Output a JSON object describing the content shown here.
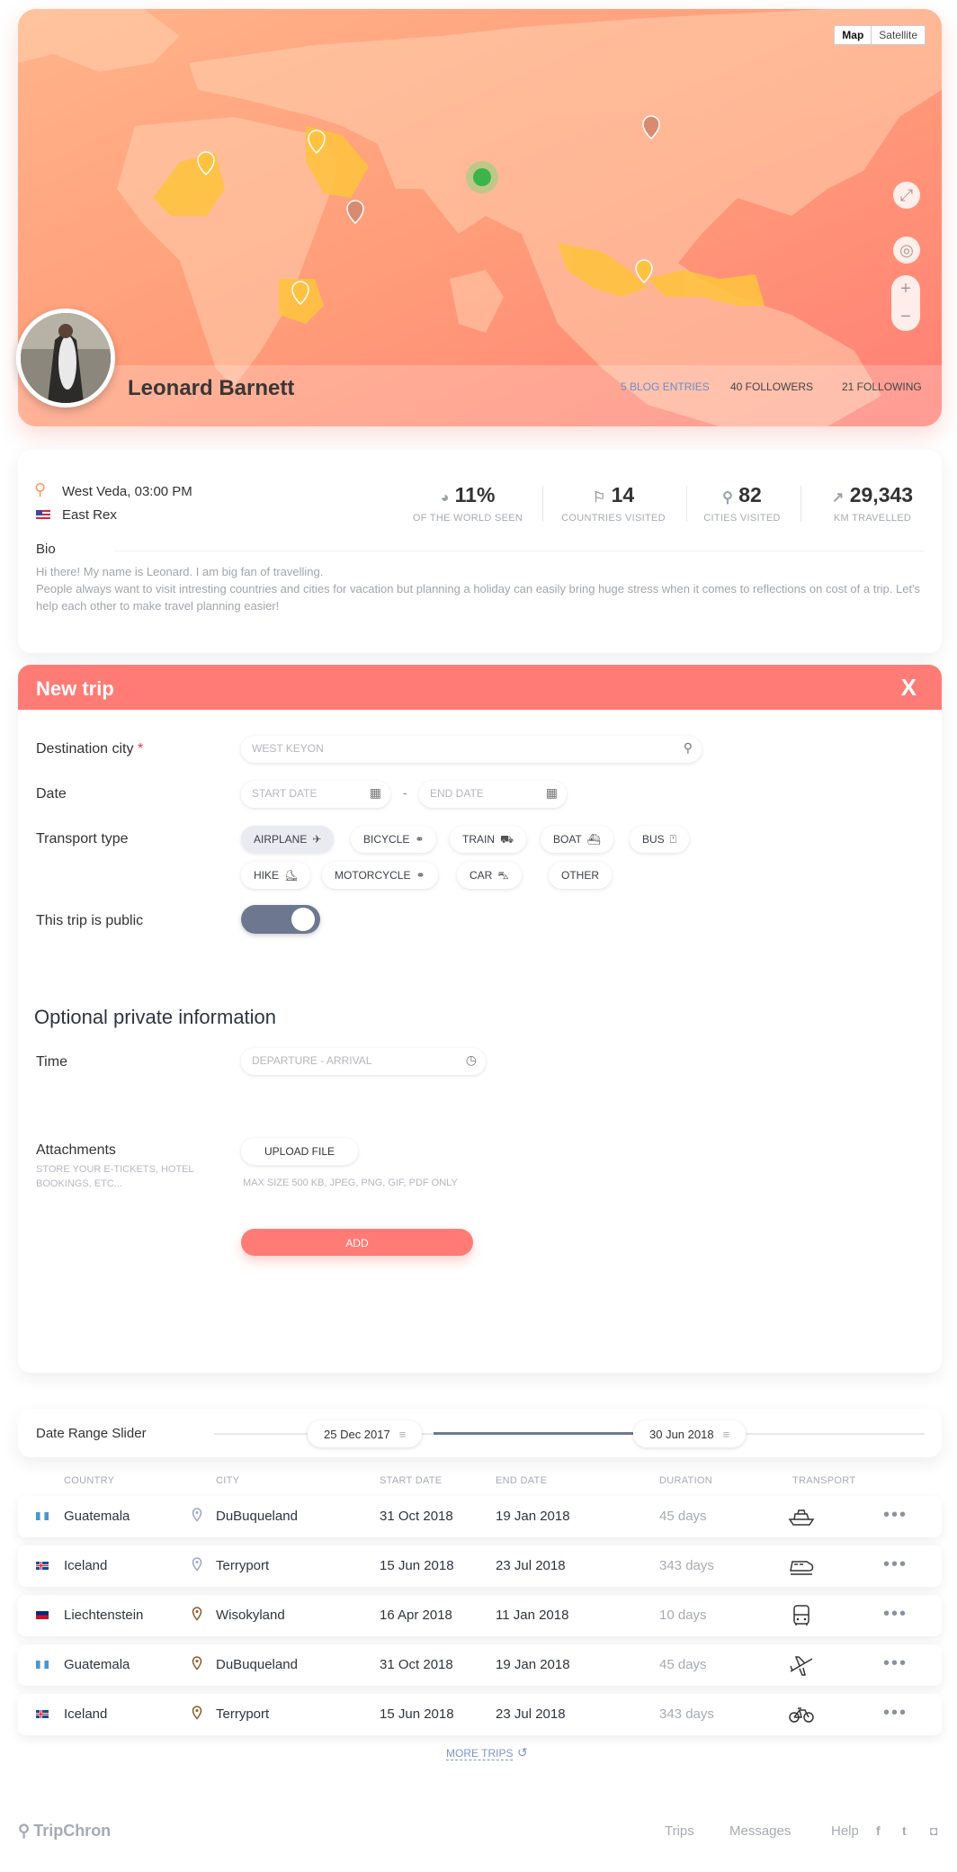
{
  "map": {
    "toggle": {
      "map": "Map",
      "satellite": "Satellite"
    },
    "profile": {
      "name": "Leonard Barnett",
      "blog_entries": "5 BLOG ENTRIES",
      "followers": "40 FOLLOWERS",
      "following": "21 FOLLOWING"
    }
  },
  "info": {
    "location": "West Veda, 03:00 PM",
    "home": "East Rex",
    "stats": [
      {
        "value": "11%",
        "label": "OF THE WORLD SEEN",
        "icon": "globe-icon"
      },
      {
        "value": "14",
        "label": "COUNTRIES VISITED",
        "icon": "flag-icon"
      },
      {
        "value": "82",
        "label": "CITIES VISITED",
        "icon": "pin-icon"
      },
      {
        "value": "29,343",
        "label": "KM TRAVELLED",
        "icon": "route-icon"
      }
    ],
    "bio_title": "Bio",
    "bio_text": "Hi there! My name is Leonard. I am big fan of travelling.\nPeople always want to visit intresting countries and cities for vacation but planning a holiday can easily bring huge stress when it comes to reflections on cost of a trip. Let's help each other to make travel planning easier!"
  },
  "trip": {
    "title": "New trip",
    "close": "X",
    "destination_label": "Destination city",
    "required_mark": "*",
    "destination_value": "WEST KEYON",
    "date_label": "Date",
    "start_placeholder": "START DATE",
    "date_sep": "-",
    "end_placeholder": "END DATE",
    "transport_label": "Transport type",
    "transports": [
      "AIRPLANE",
      "BICYCLE",
      "TRAIN",
      "BOAT",
      "BUS",
      "HIKE",
      "MOTORCYCLE",
      "CAR",
      "OTHER"
    ],
    "selected_transport": "AIRPLANE",
    "public_label": "This trip is public",
    "public_on": true,
    "optional_title": "Optional private information",
    "time_label": "Time",
    "time_placeholder": "DEPARTURE - ARRIVAL",
    "attachments_label": "Attachments",
    "attachments_sub": "STORE YOUR E-TICKETS, HOTEL BOOKINGS, ETC...",
    "upload_label": "UPLOAD FILE",
    "upload_hint": "MAX SIZE 500 KB, JPEG, PNG, GIF, PDF ONLY",
    "add_label": "ADD"
  },
  "slider": {
    "label": "Date Range Slider",
    "start": "25 Dec 2017",
    "end": "30 Jun 2018"
  },
  "table": {
    "headers": [
      "COUNTRY",
      "CITY",
      "START DATE",
      "END DATE",
      "DURATION",
      "TRANSPORT"
    ],
    "rows": [
      {
        "country": "Guatemala",
        "city": "DuBuqueland",
        "start": "31 Oct 2018",
        "end": "19 Jan 2018",
        "duration": "45 days",
        "transport": "boat-icon",
        "flag": "guatemala",
        "pin": "light"
      },
      {
        "country": "Iceland",
        "city": "Terryport",
        "start": "15 Jun 2018",
        "end": "23 Jul 2018",
        "duration": "343 days",
        "transport": "train-icon",
        "flag": "iceland",
        "pin": "light"
      },
      {
        "country": "Liechtenstein",
        "city": "Wisokyland",
        "start": "16 Apr 2018",
        "end": "11 Jan 2018",
        "duration": "10 days",
        "transport": "bus-icon",
        "flag": "liechtenstein",
        "pin": "dark"
      },
      {
        "country": "Guatemala",
        "city": "DuBuqueland",
        "start": "31 Oct 2018",
        "end": "19 Jan 2018",
        "duration": "45 days",
        "transport": "airplane-icon",
        "flag": "guatemala",
        "pin": "dark"
      },
      {
        "country": "Iceland",
        "city": "Terryport",
        "start": "15 Jun 2018",
        "end": "23 Jul 2018",
        "duration": "343 days",
        "transport": "bicycle-icon",
        "flag": "iceland",
        "pin": "dark"
      }
    ],
    "more": "MORE TRIPS"
  },
  "footer": {
    "brand": "TripChron",
    "nav": [
      "Trips",
      "Messages",
      "Help"
    ],
    "social": [
      "facebook-icon",
      "twitter-icon",
      "instagram-icon"
    ]
  },
  "colors": {
    "accent": "#ff7b76",
    "slate": "#6d7890",
    "muted": "#a6aab4",
    "link": "#7b95c8"
  }
}
